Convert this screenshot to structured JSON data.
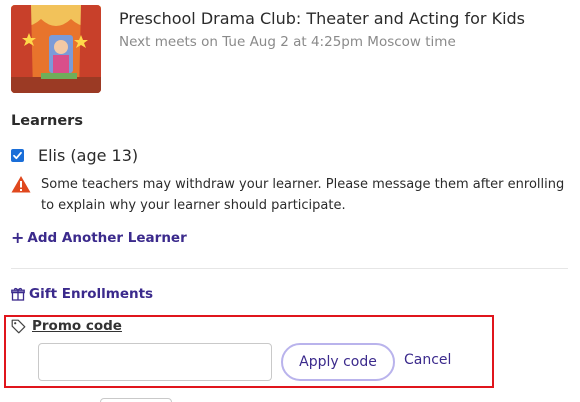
{
  "class": {
    "title": "Preschool Drama Club: Theater and Acting for Kids",
    "meta": "Next meets on Tue Aug 2 at 4:25pm Moscow time",
    "thumbnail_icon": "class-thumbnail"
  },
  "learners": {
    "heading": "Learners",
    "items": [
      {
        "label": "Elis (age 13)",
        "checked": true
      }
    ],
    "warning": "Some teachers may withdraw your learner. Please message them after enrolling to explain why your learner should participate.",
    "add_label": "Add Another Learner"
  },
  "gift": {
    "label": "Gift Enrollments"
  },
  "promo": {
    "label": "Promo code",
    "input_value": "",
    "apply_label": "Apply code",
    "cancel_label": "Cancel"
  },
  "colors": {
    "accent": "#3b2a8c",
    "checkbox": "#1a6ed8",
    "warning": "#e0481e",
    "highlight_border": "#e0151c"
  }
}
